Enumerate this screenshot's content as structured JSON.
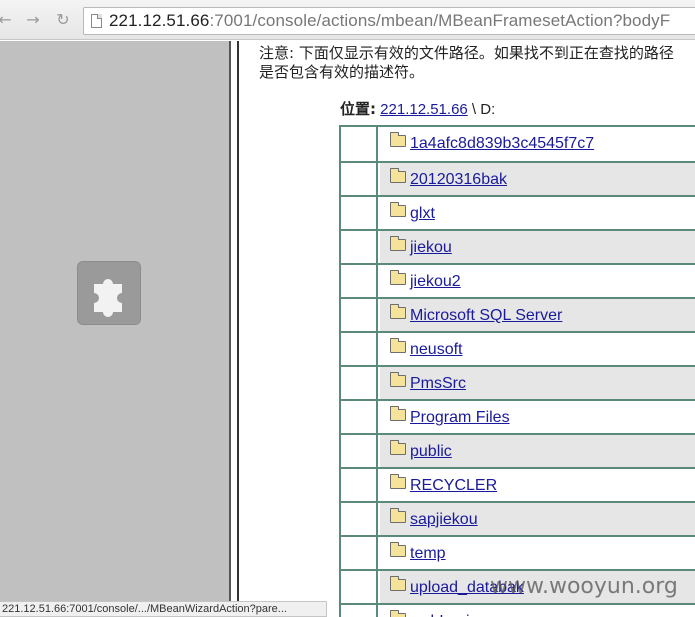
{
  "browser": {
    "url_host": "221.12.51.66",
    "url_rest": ":7001/console/actions/mbean/MBeanFramesetAction?bodyF",
    "status_url": "221.12.51.66:7001/console/.../MBeanWizardAction?pare..."
  },
  "main": {
    "notice_line1": "注意: 下面仅显示有效的文件路径。如果找不到正在查找的路径",
    "notice_line2": "是否包含有效的描述符。",
    "location_label": "位置:",
    "location_link": "221.12.51.66",
    "location_suffix": " \\ D:",
    "folders": [
      "1a4afc8d839b3c4545f7c7",
      "20120316bak",
      "glxt",
      "jiekou",
      "jiekou2",
      "Microsoft SQL Server",
      "neusoft",
      "PmsSrc",
      "Program Files",
      "public",
      "RECYCLER",
      "sapjiekou",
      "temp",
      "upload_databak",
      "webLogic"
    ]
  },
  "watermark": "www.wooyun.org",
  "icons": {
    "back": "arrow-left-icon",
    "forward": "arrow-right-icon",
    "reload": "reload-icon",
    "page": "page-icon",
    "plugin": "puzzle-piece-icon",
    "folder": "folder-icon"
  },
  "colors": {
    "link": "#1a1a9c",
    "table_border": "#5c8a7a",
    "row_alt": "#e6e6e6",
    "left_frame": "#c0c0c0"
  }
}
